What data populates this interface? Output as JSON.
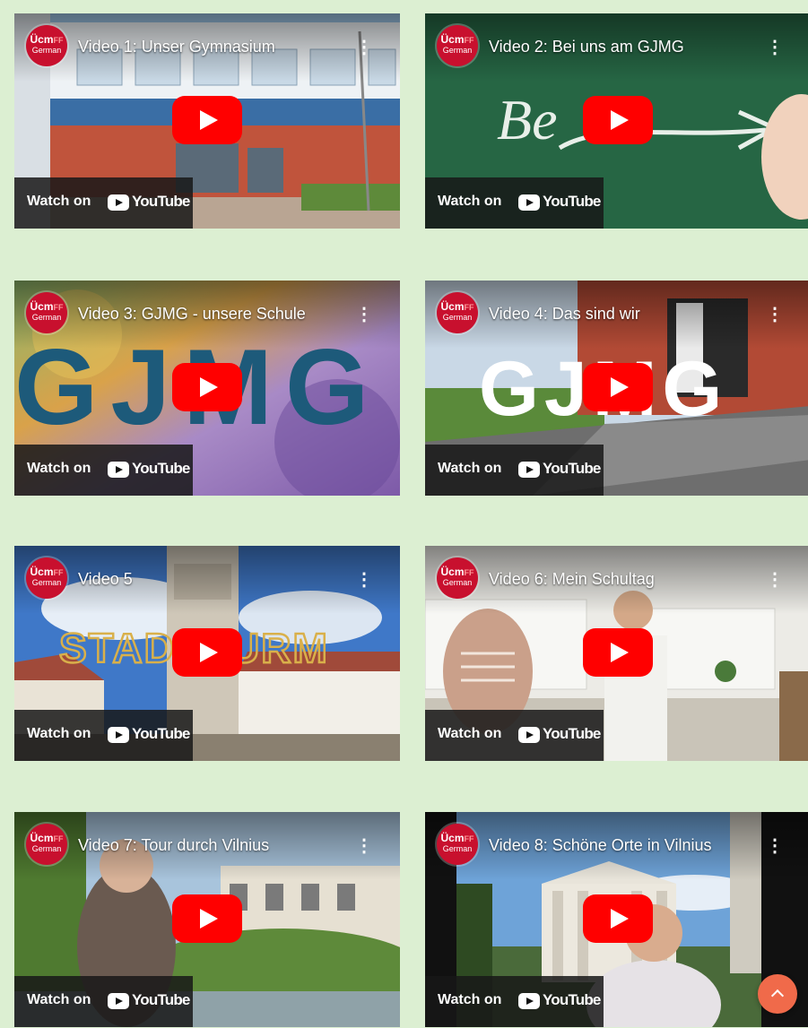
{
  "channel": {
    "logo_text": "Ücm",
    "logo_suffix": "FF",
    "logo_sub": "German"
  },
  "watch_on_label": "Watch on",
  "youtube_label": "YouTube",
  "more_label": "⋮",
  "videos": [
    {
      "title": "Video 1: Unser Gymnasium"
    },
    {
      "title": "Video 2: Bei uns am GJMG"
    },
    {
      "title": "Video 3: GJMG - unsere Schule"
    },
    {
      "title": "Video 4: Das sind wir"
    },
    {
      "title": "Video 5"
    },
    {
      "title": "Video 6: Mein Schultag"
    },
    {
      "title": "Video 7: Tour durch Vilnius"
    },
    {
      "title": "Video 8: Schöne Orte in Vilnius"
    }
  ],
  "thumbnail_text": {
    "v2": "Be",
    "v3": "GJMG",
    "v4": "GJMG",
    "v5": "STADTTURM"
  },
  "colors": {
    "page_bg": "#dcefd2",
    "play_red": "#ff0000",
    "channel_red": "#c8102e",
    "scroll_top": "#f06a4a"
  }
}
